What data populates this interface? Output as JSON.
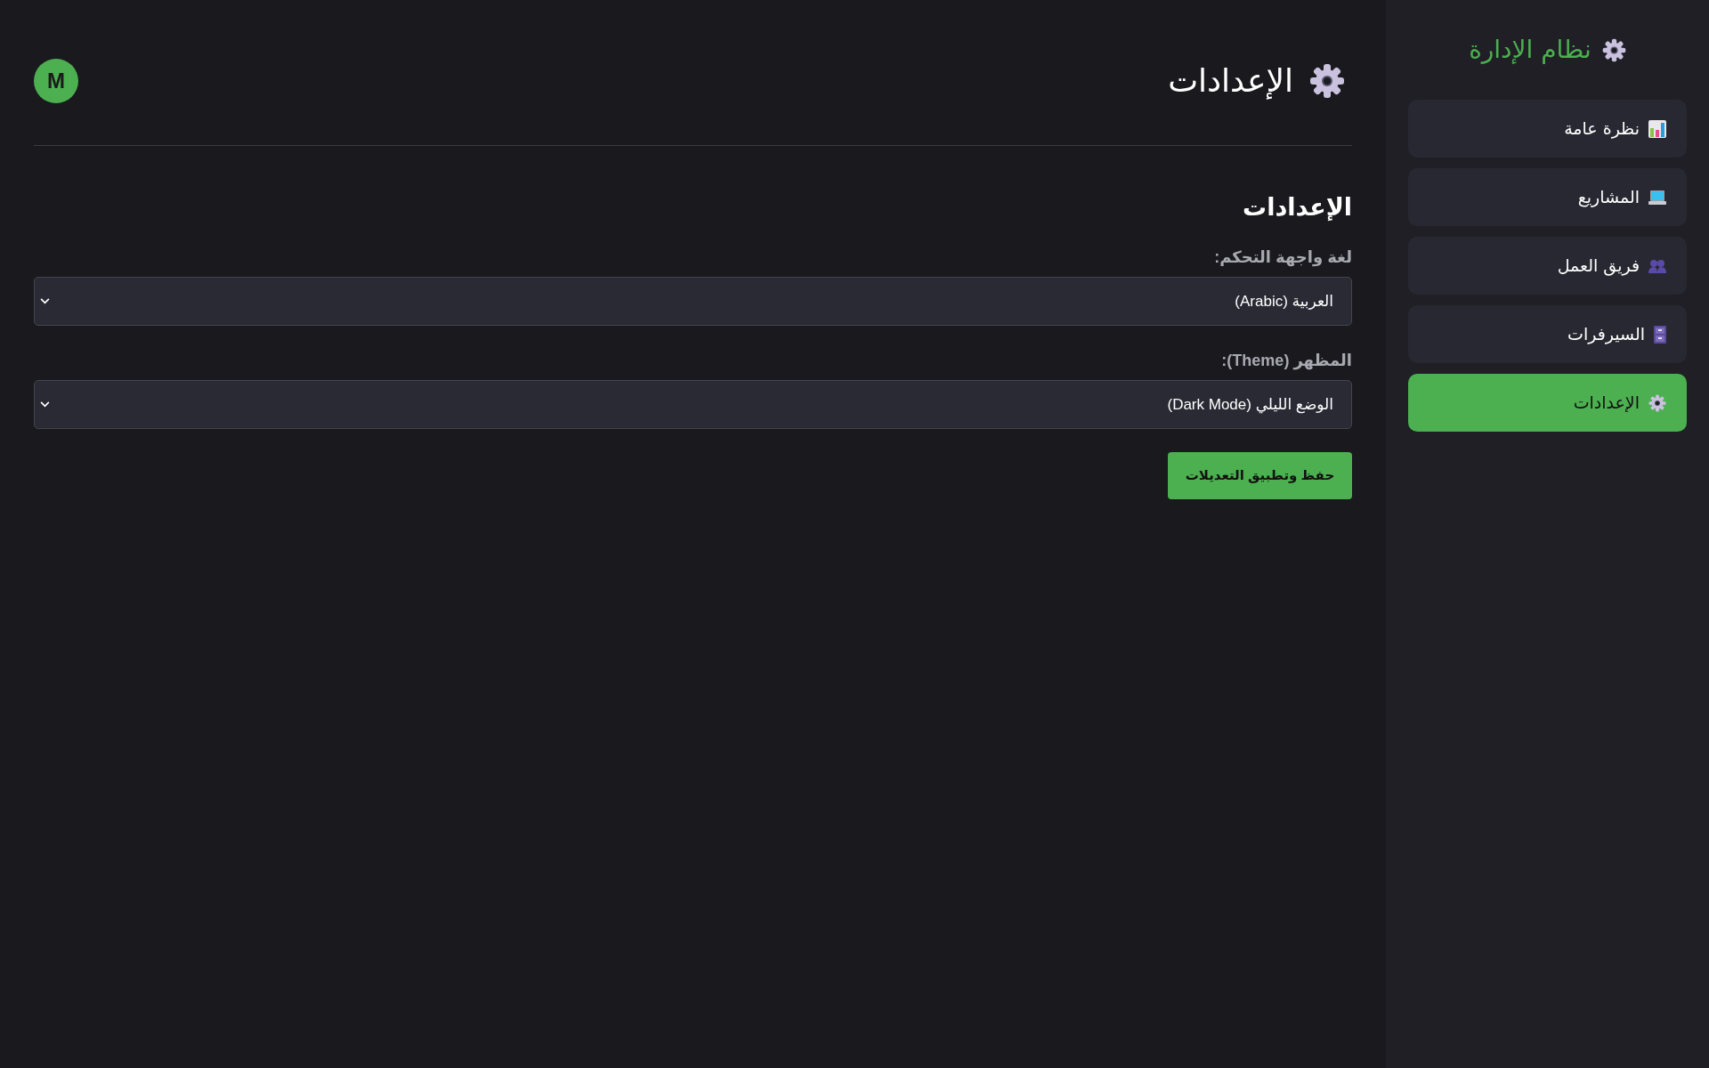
{
  "sidebar": {
    "title": "نظام الإدارة",
    "items": [
      {
        "label": "نظرة عامة",
        "selected": false
      },
      {
        "label": "المشاريع",
        "selected": false
      },
      {
        "label": "فريق العمل",
        "selected": false
      },
      {
        "label": "السيرفرات",
        "selected": false
      },
      {
        "label": "الإعدادات",
        "selected": true
      }
    ]
  },
  "header": {
    "title": "الإعدادات",
    "avatar": "M"
  },
  "settings": {
    "heading": "الإعدادات",
    "fields": [
      {
        "label": "لغة واجهة التحكم:",
        "value": "العربية (Arabic)"
      },
      {
        "label": "المظهر (Theme):",
        "value": "الوضع الليلي (Dark Mode)"
      }
    ],
    "save_button": "حفظ وتطبيق التعديلات"
  }
}
